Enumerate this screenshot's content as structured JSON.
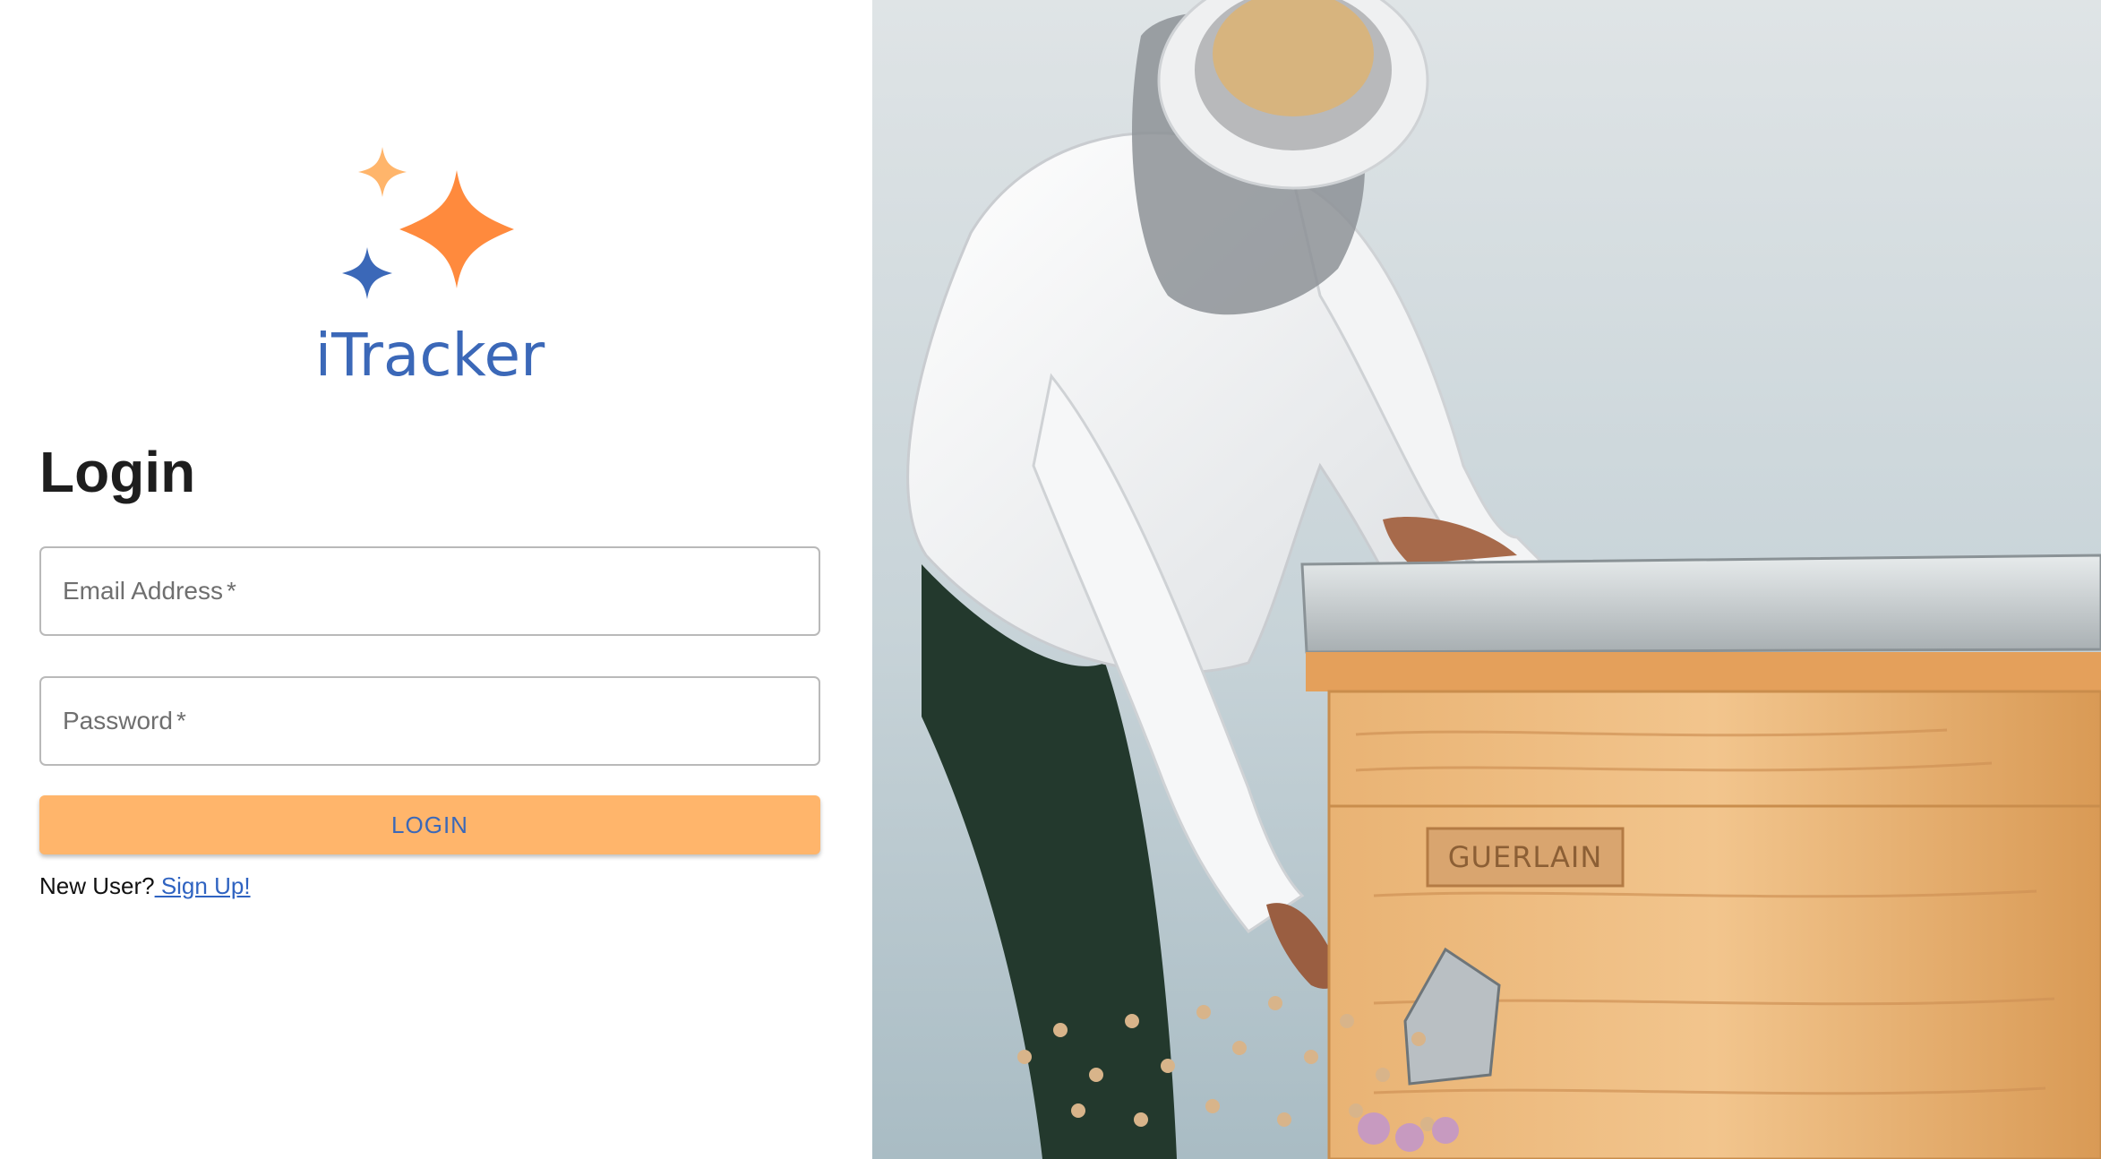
{
  "brand": {
    "name": "iTracker",
    "colors": {
      "star_light_orange": "#ffb56b",
      "star_orange": "#ff8a3d",
      "star_blue": "#3b68b8",
      "text_blue": "#3b68b8"
    },
    "icon": "sparkles-logo-icon"
  },
  "login": {
    "title": "Login",
    "email_label": "Email Address",
    "email_required": "*",
    "email_value": "",
    "password_label": "Password",
    "password_required": "*",
    "password_value": "",
    "button_label": "LOGIN",
    "button_color": "#ffb56b",
    "new_user_text": "New User?",
    "signup_link": " Sign Up!"
  },
  "hero": {
    "hive_brand": "GUERLAIN",
    "image_subject": "beekeeper-at-hive-photo"
  }
}
